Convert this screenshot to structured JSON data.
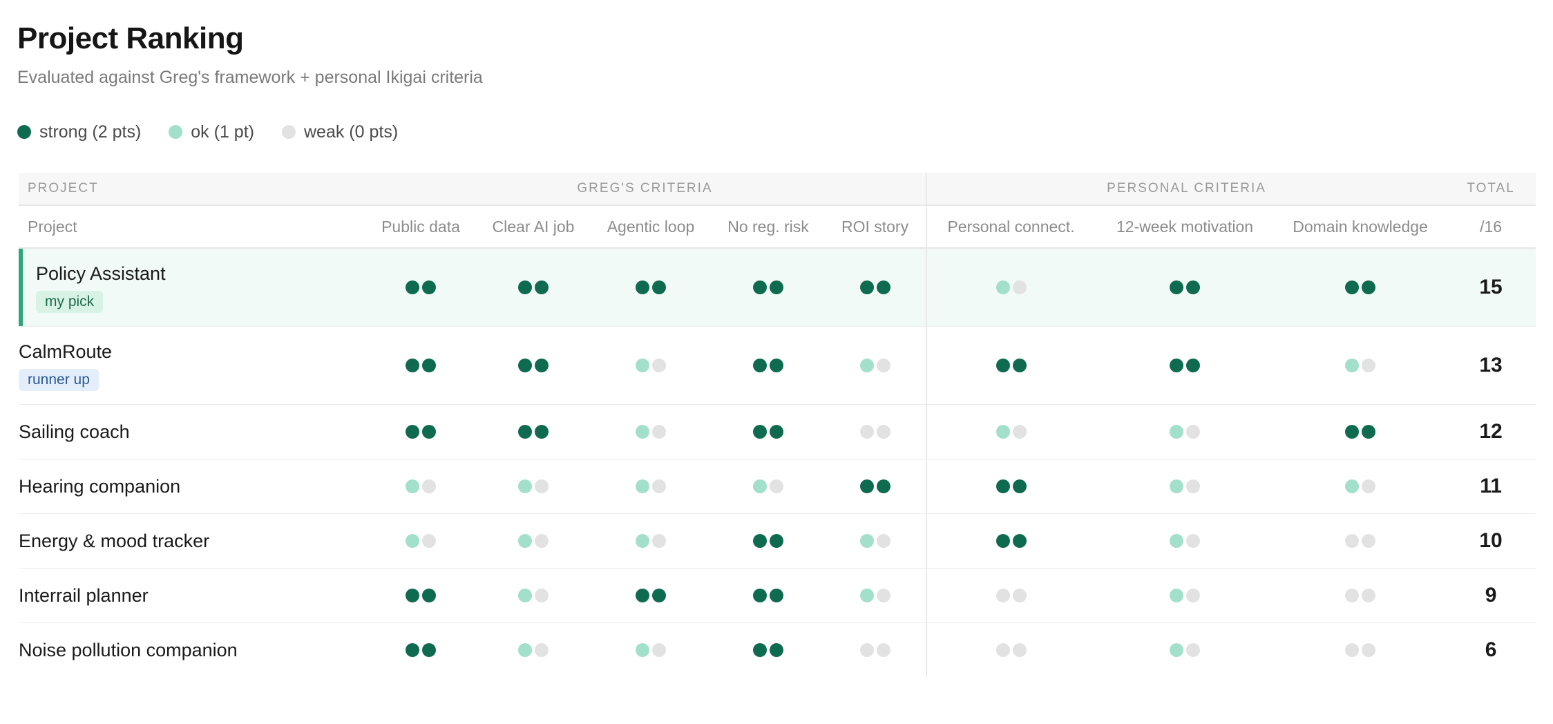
{
  "page": {
    "title": "Project Ranking",
    "subtitle": "Evaluated against Greg's framework + personal Ikigai criteria"
  },
  "legend": [
    {
      "level": "strong",
      "label": "strong (2 pts)"
    },
    {
      "level": "ok",
      "label": "ok (1 pt)"
    },
    {
      "level": "weak",
      "label": "weak (0 pts)"
    }
  ],
  "colors": {
    "strong": "#0f6b50",
    "ok": "#a3e0cb",
    "weak": "#e2e2e2",
    "pick_accent": "#2ea57d"
  },
  "table": {
    "group_headers": {
      "project": "PROJECT",
      "greg": "GREG'S CRITERIA",
      "personal": "PERSONAL CRITERIA",
      "total": "TOTAL"
    },
    "columns": [
      "Project",
      "Public data",
      "Clear AI job",
      "Agentic loop",
      "No reg. risk",
      "ROI story",
      "Personal connect.",
      "12-week motivation",
      "Domain knowledge",
      "/16"
    ],
    "rows": [
      {
        "name": "Policy Assistant",
        "badge": "my pick",
        "badge_type": "pick",
        "scores": [
          2,
          2,
          2,
          2,
          2,
          1,
          2,
          2
        ],
        "total": "15"
      },
      {
        "name": "CalmRoute",
        "badge": "runner up",
        "badge_type": "runner",
        "scores": [
          2,
          2,
          1,
          2,
          1,
          2,
          2,
          1
        ],
        "total": "13"
      },
      {
        "name": "Sailing coach",
        "badge": "",
        "badge_type": "",
        "scores": [
          2,
          2,
          1,
          2,
          0,
          1,
          1,
          2
        ],
        "total": "12"
      },
      {
        "name": "Hearing companion",
        "badge": "",
        "badge_type": "",
        "scores": [
          1,
          1,
          1,
          1,
          2,
          2,
          1,
          1
        ],
        "total": "11"
      },
      {
        "name": "Energy & mood tracker",
        "badge": "",
        "badge_type": "",
        "scores": [
          1,
          1,
          1,
          2,
          1,
          2,
          1,
          0
        ],
        "total": "10"
      },
      {
        "name": "Interrail planner",
        "badge": "",
        "badge_type": "",
        "scores": [
          2,
          1,
          2,
          2,
          1,
          0,
          1,
          0
        ],
        "total": "9"
      },
      {
        "name": "Noise pollution companion",
        "badge": "",
        "badge_type": "",
        "scores": [
          2,
          1,
          1,
          2,
          0,
          0,
          1,
          0
        ],
        "total": "6"
      }
    ]
  }
}
